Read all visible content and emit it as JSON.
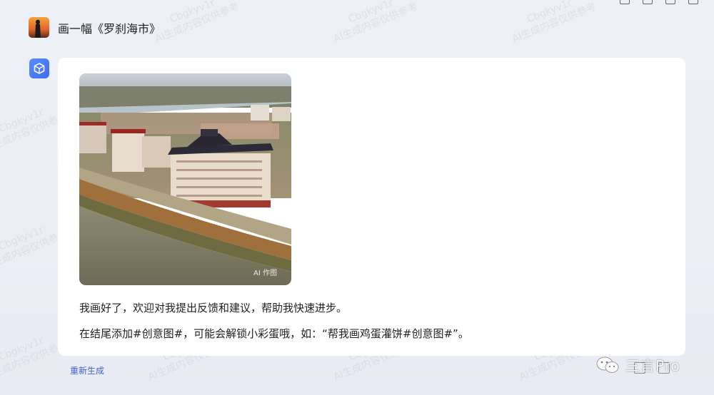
{
  "conversation": {
    "user_prompt": "画一幅《罗刹海市》",
    "image_tag": "AI 作图",
    "reply_line1": "我画好了，欢迎对我提出反馈和建议，帮助我快速进步。",
    "reply_line2": "在结尾添加#创意图#，可能会解锁小彩蛋哦，如：“帮我画鸡蛋灌饼#创意图#”。",
    "regenerate_label": "重新生成"
  },
  "watermark": {
    "line1": "Cbgkyv1r",
    "line2": "AI生成内容仅供参考"
  },
  "branding": {
    "name": "三言Pro"
  },
  "colors": {
    "link": "#3b63d6",
    "bot_avatar": "#4a78f5",
    "card": "#ffffff",
    "page_bg": "#eceef6"
  },
  "icons": {
    "bot_avatar": "cube-icon",
    "brand": "wechat-icon"
  }
}
